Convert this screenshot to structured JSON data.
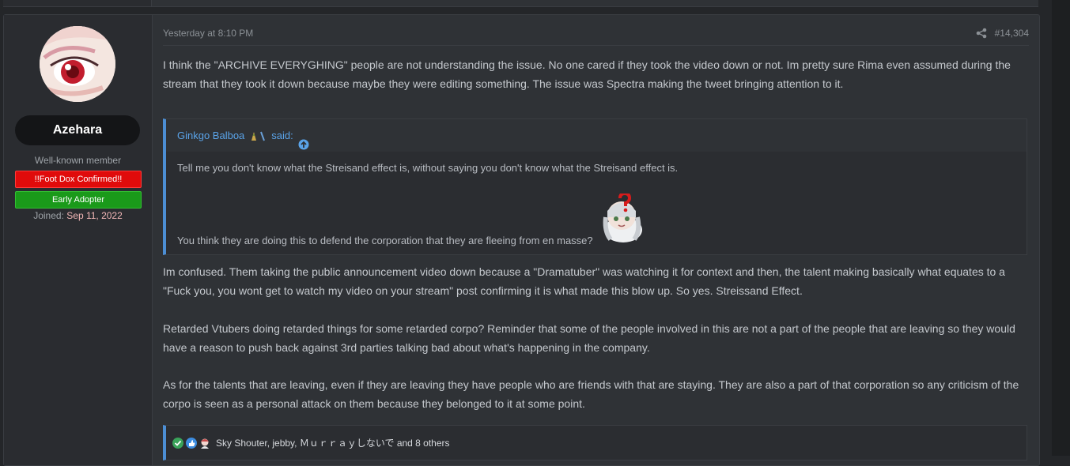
{
  "user": {
    "name": "Azehara",
    "title": "Well-known member",
    "banners": [
      "!!Foot Dox Confirmed!!",
      "Early Adopter"
    ],
    "joined_label": "Joined:",
    "joined_date": "Sep 11, 2022"
  },
  "post": {
    "date": "Yesterday at 8:10 PM",
    "number": "#14,304",
    "paragraphs": [
      "I think the \"ARCHIVE EVERYGHING\" people are not understanding the issue. No one cared if they took the video down or not. Im pretty sure Rima even assumed during the stream that they took it down because maybe they were editing something. The issue was Spectra making the tweet bringing attention to it.",
      "Im confused. Them taking the public announcement video down because a \"Dramatuber\" was watching it for context and then, the talent making basically what equates to a \"Fuck you, you wont get to watch my video on your stream\" post confirming it is what made this blow up. So yes. Streissand Effect.",
      "Retarded Vtubers doing retarded things for some retarded corpo? Reminder that some of the people involved in this are not a part of the people that are leaving so they would have a reason to push back against 3rd parties talking bad about what's happening in the company.",
      "As for the talents that are leaving, even if they are leaving they have people who are friends with that are staying. They are also a part of that corporation so any criticism of the corpo is seen as a personal attack on them because they belonged to it at some point."
    ]
  },
  "quote": {
    "author": "Ginkgo Balboa",
    "said": "said:",
    "line1": "Tell me you don't know what the Streisand effect is, without saying you don't know what the Streisand effect is.",
    "line2": "You think they are doing this to defend the corporation that they are fleeing from en masse?"
  },
  "reactions": {
    "text": "Sky Shouter, jebby, Ｍｕｒｒａｙしないで and 8 others",
    "icons": [
      "check-icon",
      "thumbs-up-icon",
      "character-icon"
    ]
  },
  "colors": {
    "accent": "#4c8ed4",
    "banner_red": "#e00b0b",
    "banner_green": "#1a9a1a",
    "joined_date": "#f2b7b7"
  }
}
